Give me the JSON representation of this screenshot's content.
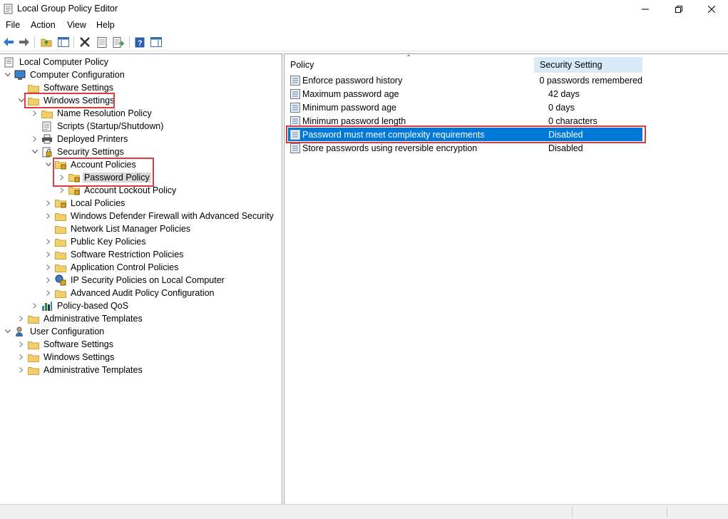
{
  "window": {
    "title": "Local Group Policy Editor",
    "controls": {
      "minimize": "minimize-icon",
      "maximize": "restore-icon",
      "close": "close-icon"
    }
  },
  "menu": [
    "File",
    "Action",
    "View",
    "Help"
  ],
  "toolbar": {
    "icons": [
      "back-arrow-icon",
      "forward-arrow-icon",
      "up-folder-icon",
      "show-hide-tree-icon",
      "delete-icon",
      "properties-icon",
      "export-list-icon",
      "help-icon",
      "show-hide-action-pane-icon"
    ]
  },
  "tree": {
    "root": "Local Computer Policy",
    "computer_configuration": "Computer Configuration",
    "software_settings": "Software Settings",
    "windows_settings": "Windows Settings",
    "name_resolution_policy": "Name Resolution Policy",
    "scripts": "Scripts (Startup/Shutdown)",
    "deployed_printers": "Deployed Printers",
    "security_settings": "Security Settings",
    "account_policies": "Account Policies",
    "password_policy": "Password Policy",
    "account_lockout_policy": "Account Lockout Policy",
    "local_policies": "Local Policies",
    "windows_defender_firewall": "Windows Defender Firewall with Advanced Security",
    "network_list_manager": "Network List Manager Policies",
    "public_key_policies": "Public Key Policies",
    "software_restriction": "Software Restriction Policies",
    "application_control": "Application Control Policies",
    "ip_security": "IP Security Policies on Local Computer",
    "advanced_audit": "Advanced Audit Policy Configuration",
    "policy_qos": "Policy-based QoS",
    "admin_templates": "Administrative Templates",
    "user_configuration": "User Configuration",
    "user_software_settings": "Software Settings",
    "user_windows_settings": "Windows Settings",
    "user_admin_templates": "Administrative Templates"
  },
  "list": {
    "columns": {
      "policy": "Policy",
      "setting": "Security Setting"
    },
    "rows": [
      {
        "policy": "Enforce password history",
        "setting": "0 passwords remembered"
      },
      {
        "policy": "Maximum password age",
        "setting": "42 days"
      },
      {
        "policy": "Minimum password age",
        "setting": "0 days"
      },
      {
        "policy": "Minimum password length",
        "setting": "0 characters"
      },
      {
        "policy": "Password must meet complexity requirements",
        "setting": "Disabled"
      },
      {
        "policy": "Store passwords using reversible encryption",
        "setting": "Disabled"
      }
    ],
    "selected_index": 4
  },
  "colors": {
    "selection": "#0078d7",
    "highlight_box": "#e0393e",
    "folder": "#e8c15a"
  }
}
